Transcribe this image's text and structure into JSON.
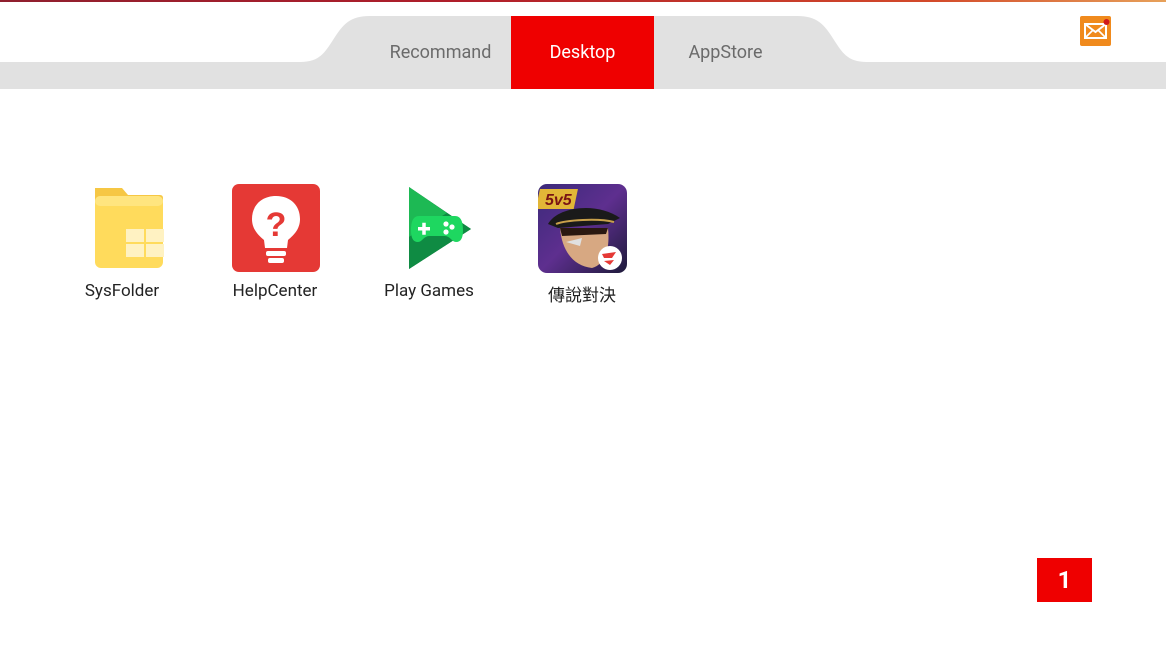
{
  "tabs": [
    {
      "label": "Recommand",
      "active": false
    },
    {
      "label": "Desktop",
      "active": true
    },
    {
      "label": "AppStore",
      "active": false
    }
  ],
  "header": {
    "mail_icon": "mail-envelope-icon",
    "mail_has_notification": true
  },
  "apps": [
    {
      "label": "SysFolder",
      "icon": "folder-icon"
    },
    {
      "label": "HelpCenter",
      "icon": "help-lightbulb-icon"
    },
    {
      "label": "Play Games",
      "icon": "play-games-icon"
    },
    {
      "label": "傳說對決",
      "icon": "arena-of-valor-icon"
    }
  ],
  "pager": {
    "current_page": "1"
  },
  "colors": {
    "accent": "#ef0000",
    "tab_bar": "#e1e1e1",
    "mail_orange": "#f08a1d",
    "folder_yellow": "#ffd95a",
    "help_red": "#e53935",
    "play_green": "#1db954"
  }
}
